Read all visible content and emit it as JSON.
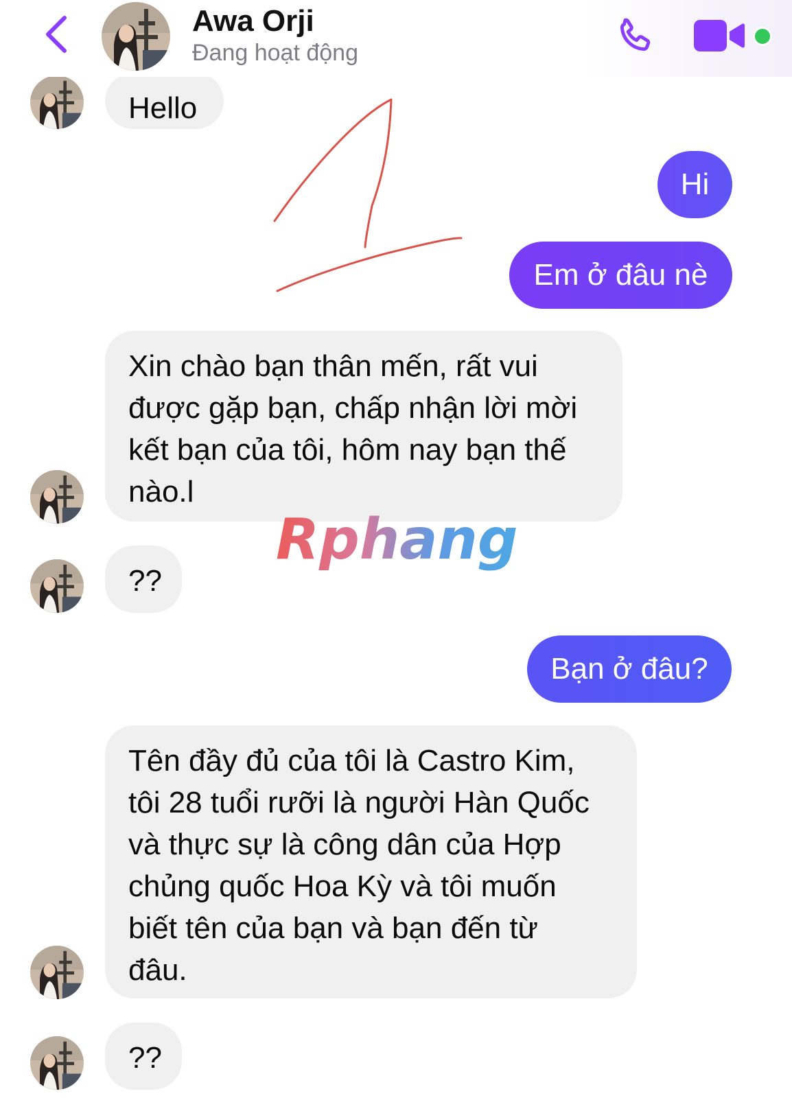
{
  "header": {
    "contact_name": "Awa Orji",
    "status": "Đang hoạt động",
    "icons": {
      "back": "chevron-left-icon",
      "call": "phone-icon",
      "video": "video-camera-icon",
      "online": "online-status-dot"
    }
  },
  "messages": [
    {
      "sender": "them",
      "lines": [
        "Hello"
      ]
    },
    {
      "sender": "me",
      "lines": [
        "Hi"
      ]
    },
    {
      "sender": "me",
      "lines": [
        "Em ở đâu nè"
      ]
    },
    {
      "sender": "them",
      "lines": [
        "Xin chào bạn thân mến, rất vui",
        "được gặp bạn, chấp nhận lời mời",
        "kết bạn của tôi, hôm nay bạn thế",
        "nào.l"
      ]
    },
    {
      "sender": "them",
      "lines": [
        "??"
      ]
    },
    {
      "sender": "me",
      "lines": [
        "Bạn ở đâu?"
      ]
    },
    {
      "sender": "them",
      "lines": [
        "Tên đầy đủ của tôi là Castro Kim,",
        "tôi 28 tuổi rưỡi là người Hàn Quốc",
        "và thực sự là công dân của Hợp",
        "chủng quốc Hoa Kỳ và tôi muốn",
        "biết tên của bạn và bạn đến từ",
        "đâu."
      ]
    },
    {
      "sender": "them",
      "lines": [
        "??"
      ]
    }
  ],
  "watermark": {
    "text": "Rphang"
  },
  "colors": {
    "accent": "#8b3dff",
    "outgoing_start": "#7a3cf5",
    "outgoing_end": "#4f5cf5",
    "incoming_bg": "#f0f0f0",
    "online": "#34c759",
    "annotation": "#d9534a"
  }
}
